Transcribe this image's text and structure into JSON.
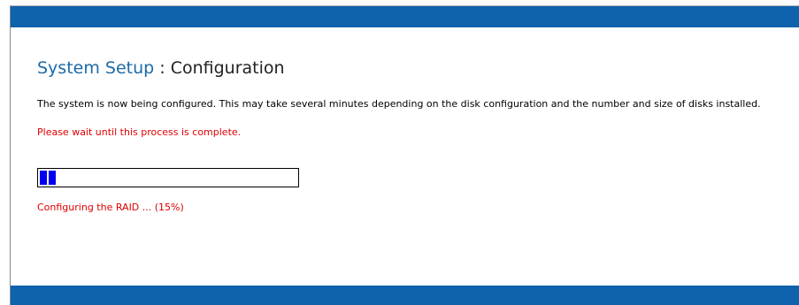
{
  "header": {
    "title_main": "System Setup",
    "title_separator": " : ",
    "title_sub": "Configuration"
  },
  "main": {
    "description": "The system is now being configured. This may take several minutes depending on the disk configuration and the number and size of disks installed.",
    "wait_message": "Please wait until this process is complete.",
    "progress": {
      "percent": 15,
      "filled_blocks": 2
    },
    "status_text": "Configuring the RAID ... (15%)"
  },
  "colors": {
    "bar_blue": "#0f62ac",
    "title_blue": "#1c6aaa",
    "alert_red": "#e00000",
    "progress_blue": "#0000ee"
  }
}
